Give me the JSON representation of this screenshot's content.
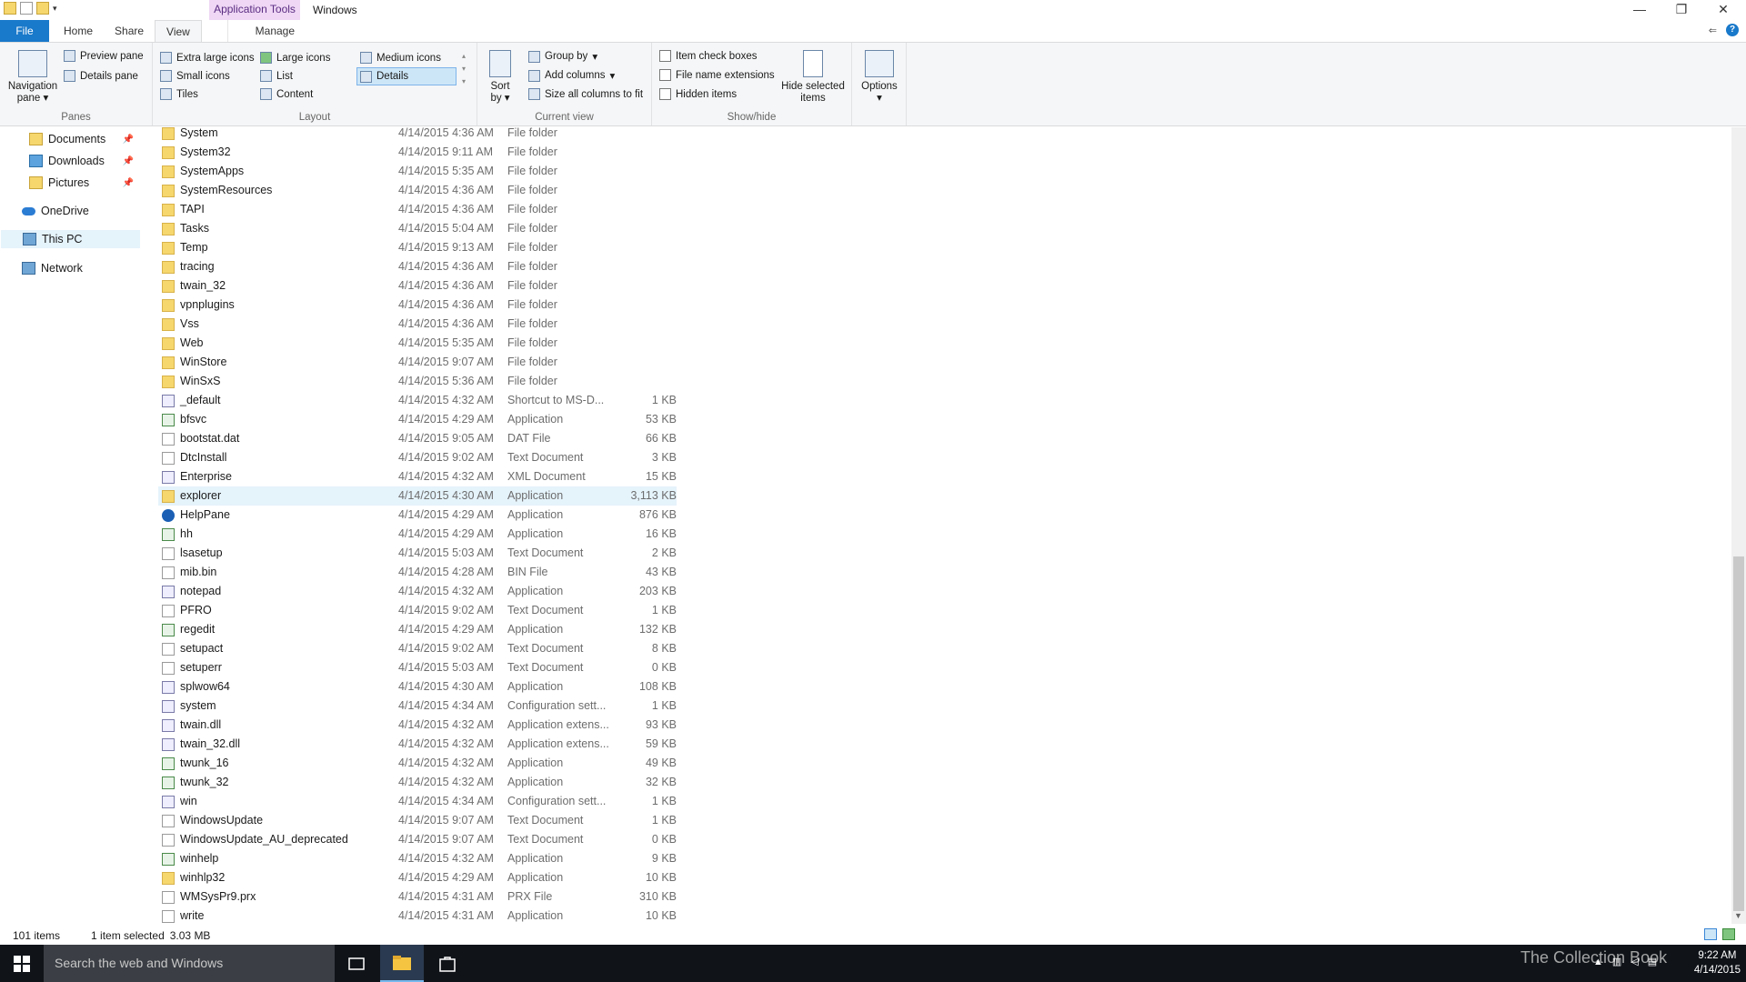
{
  "title_bar": {
    "context_tab": "Application Tools",
    "window_title": "Windows",
    "minimize": "—",
    "maximize": "❐",
    "close": "✕"
  },
  "ribbon_tabs": {
    "file": "File",
    "home": "Home",
    "share": "Share",
    "view": "View",
    "manage": "Manage"
  },
  "ribbon": {
    "panes": {
      "label": "Panes",
      "navigation_pane": "Navigation pane",
      "preview_pane": "Preview pane",
      "details_pane": "Details pane"
    },
    "layout": {
      "label": "Layout",
      "extra_large_icons": "Extra large icons",
      "large_icons": "Large icons",
      "medium_icons": "Medium icons",
      "small_icons": "Small icons",
      "list": "List",
      "details": "Details",
      "tiles": "Tiles",
      "content": "Content"
    },
    "current_view": {
      "label": "Current view",
      "sort_by": "Sort by",
      "group_by": "Group by",
      "add_columns": "Add columns",
      "size_all_columns": "Size all columns to fit"
    },
    "show_hide": {
      "label": "Show/hide",
      "item_check_boxes": "Item check boxes",
      "file_name_extensions": "File name extensions",
      "hidden_items": "Hidden items",
      "hide_selected_items": "Hide selected items"
    },
    "options": "Options"
  },
  "nav_pane": {
    "items": [
      {
        "label": "Documents",
        "pinned": true
      },
      {
        "label": "Downloads",
        "pinned": true
      },
      {
        "label": "Pictures",
        "pinned": true
      },
      {
        "label": "OneDrive",
        "pinned": false
      },
      {
        "label": "This PC",
        "pinned": false
      },
      {
        "label": "Network",
        "pinned": false
      }
    ]
  },
  "files": [
    {
      "name": "System",
      "date": "4/14/2015 4:36 AM",
      "type": "File folder",
      "size": "",
      "icon": "folder-icon"
    },
    {
      "name": "System32",
      "date": "4/14/2015 9:11 AM",
      "type": "File folder",
      "size": "",
      "icon": "folder-icon"
    },
    {
      "name": "SystemApps",
      "date": "4/14/2015 5:35 AM",
      "type": "File folder",
      "size": "",
      "icon": "folder-icon"
    },
    {
      "name": "SystemResources",
      "date": "4/14/2015 4:36 AM",
      "type": "File folder",
      "size": "",
      "icon": "folder-icon"
    },
    {
      "name": "TAPI",
      "date": "4/14/2015 4:36 AM",
      "type": "File folder",
      "size": "",
      "icon": "folder-icon"
    },
    {
      "name": "Tasks",
      "date": "4/14/2015 5:04 AM",
      "type": "File folder",
      "size": "",
      "icon": "folder-icon"
    },
    {
      "name": "Temp",
      "date": "4/14/2015 9:13 AM",
      "type": "File folder",
      "size": "",
      "icon": "folder-icon"
    },
    {
      "name": "tracing",
      "date": "4/14/2015 4:36 AM",
      "type": "File folder",
      "size": "",
      "icon": "folder-icon"
    },
    {
      "name": "twain_32",
      "date": "4/14/2015 4:36 AM",
      "type": "File folder",
      "size": "",
      "icon": "folder-icon"
    },
    {
      "name": "vpnplugins",
      "date": "4/14/2015 4:36 AM",
      "type": "File folder",
      "size": "",
      "icon": "folder-icon"
    },
    {
      "name": "Vss",
      "date": "4/14/2015 4:36 AM",
      "type": "File folder",
      "size": "",
      "icon": "folder-icon"
    },
    {
      "name": "Web",
      "date": "4/14/2015 5:35 AM",
      "type": "File folder",
      "size": "",
      "icon": "folder-icon"
    },
    {
      "name": "WinStore",
      "date": "4/14/2015 9:07 AM",
      "type": "File folder",
      "size": "",
      "icon": "folder-icon"
    },
    {
      "name": "WinSxS",
      "date": "4/14/2015 5:36 AM",
      "type": "File folder",
      "size": "",
      "icon": "folder-icon"
    },
    {
      "name": "_default",
      "date": "4/14/2015 4:32 AM",
      "type": "Shortcut to MS-D...",
      "size": "1 KB",
      "icon": "shortcut-icon"
    },
    {
      "name": "bfsvc",
      "date": "4/14/2015 4:29 AM",
      "type": "Application",
      "size": "53 KB",
      "icon": "application-icon"
    },
    {
      "name": "bootstat.dat",
      "date": "4/14/2015 9:05 AM",
      "type": "DAT File",
      "size": "66 KB",
      "icon": "document-icon"
    },
    {
      "name": "DtcInstall",
      "date": "4/14/2015 9:02 AM",
      "type": "Text Document",
      "size": "3 KB",
      "icon": "document-icon"
    },
    {
      "name": "Enterprise",
      "date": "4/14/2015 4:32 AM",
      "type": "XML Document",
      "size": "15 KB",
      "icon": "xml-icon"
    },
    {
      "name": "explorer",
      "date": "4/14/2015 4:30 AM",
      "type": "Application",
      "size": "3,113 KB",
      "icon": "explorer-icon",
      "selected": true
    },
    {
      "name": "HelpPane",
      "date": "4/14/2015 4:29 AM",
      "type": "Application",
      "size": "876 KB",
      "icon": "help-icon"
    },
    {
      "name": "hh",
      "date": "4/14/2015 4:29 AM",
      "type": "Application",
      "size": "16 KB",
      "icon": "application-icon"
    },
    {
      "name": "lsasetup",
      "date": "4/14/2015 5:03 AM",
      "type": "Text Document",
      "size": "2 KB",
      "icon": "document-icon"
    },
    {
      "name": "mib.bin",
      "date": "4/14/2015 4:28 AM",
      "type": "BIN File",
      "size": "43 KB",
      "icon": "document-icon"
    },
    {
      "name": "notepad",
      "date": "4/14/2015 4:32 AM",
      "type": "Application",
      "size": "203 KB",
      "icon": "notepad-icon"
    },
    {
      "name": "PFRO",
      "date": "4/14/2015 9:02 AM",
      "type": "Text Document",
      "size": "1 KB",
      "icon": "document-icon"
    },
    {
      "name": "regedit",
      "date": "4/14/2015 4:29 AM",
      "type": "Application",
      "size": "132 KB",
      "icon": "regedit-icon"
    },
    {
      "name": "setupact",
      "date": "4/14/2015 9:02 AM",
      "type": "Text Document",
      "size": "8 KB",
      "icon": "document-icon"
    },
    {
      "name": "setuperr",
      "date": "4/14/2015 5:03 AM",
      "type": "Text Document",
      "size": "0 KB",
      "icon": "document-icon"
    },
    {
      "name": "splwow64",
      "date": "4/14/2015 4:30 AM",
      "type": "Application",
      "size": "108 KB",
      "icon": "printer-icon"
    },
    {
      "name": "system",
      "date": "4/14/2015 4:34 AM",
      "type": "Configuration sett...",
      "size": "1 KB",
      "icon": "config-icon"
    },
    {
      "name": "twain.dll",
      "date": "4/14/2015 4:32 AM",
      "type": "Application extens...",
      "size": "93 KB",
      "icon": "config-icon"
    },
    {
      "name": "twain_32.dll",
      "date": "4/14/2015 4:32 AM",
      "type": "Application extens...",
      "size": "59 KB",
      "icon": "config-icon"
    },
    {
      "name": "twunk_16",
      "date": "4/14/2015 4:32 AM",
      "type": "Application",
      "size": "49 KB",
      "icon": "application-icon"
    },
    {
      "name": "twunk_32",
      "date": "4/14/2015 4:32 AM",
      "type": "Application",
      "size": "32 KB",
      "icon": "application-icon"
    },
    {
      "name": "win",
      "date": "4/14/2015 4:34 AM",
      "type": "Configuration sett...",
      "size": "1 KB",
      "icon": "config-icon"
    },
    {
      "name": "WindowsUpdate",
      "date": "4/14/2015 9:07 AM",
      "type": "Text Document",
      "size": "1 KB",
      "icon": "document-icon"
    },
    {
      "name": "WindowsUpdate_AU_deprecated",
      "date": "4/14/2015 9:07 AM",
      "type": "Text Document",
      "size": "0 KB",
      "icon": "document-icon"
    },
    {
      "name": "winhelp",
      "date": "4/14/2015 4:32 AM",
      "type": "Application",
      "size": "9 KB",
      "icon": "application-icon"
    },
    {
      "name": "winhlp32",
      "date": "4/14/2015 4:29 AM",
      "type": "Application",
      "size": "10 KB",
      "icon": "winhelp-icon"
    },
    {
      "name": "WMSysPr9.prx",
      "date": "4/14/2015 4:31 AM",
      "type": "PRX File",
      "size": "310 KB",
      "icon": "document-icon"
    },
    {
      "name": "write",
      "date": "4/14/2015 4:31 AM",
      "type": "Application",
      "size": "10 KB",
      "icon": "write-icon"
    }
  ],
  "status_bar": {
    "item_count": "101 items",
    "selection": "1 item selected",
    "selection_size": "3.03 MB"
  },
  "taskbar": {
    "search_placeholder": "Search the web and Windows",
    "watermark": "The Collection Book",
    "time": "9:22 AM",
    "date": "4/14/2015"
  },
  "colors": {
    "accent": "#1979ca",
    "context_tab": "#efd7f5",
    "selection": "#e5f3fb",
    "taskbar": "#101419"
  }
}
